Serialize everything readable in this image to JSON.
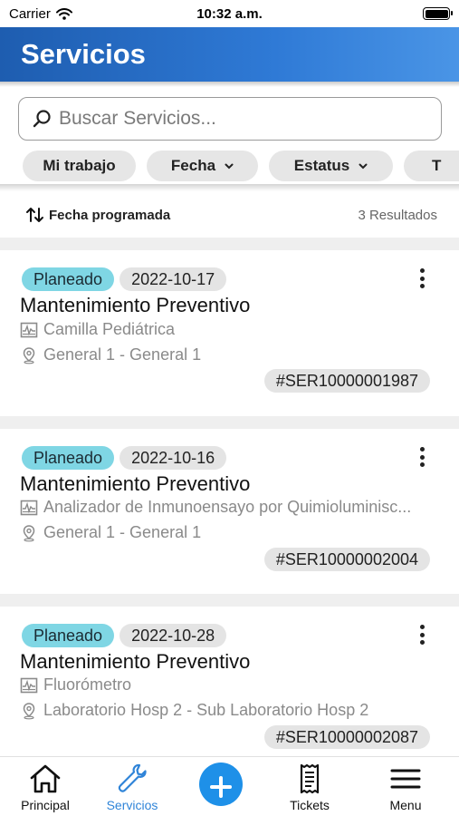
{
  "status_bar": {
    "carrier": "Carrier",
    "time": "10:32 a.m."
  },
  "header": {
    "title": "Servicios"
  },
  "search": {
    "placeholder": "Buscar Servicios..."
  },
  "filters": [
    {
      "label": "Mi trabajo",
      "has_dropdown": false
    },
    {
      "label": "Fecha",
      "has_dropdown": true
    },
    {
      "label": "Estatus",
      "has_dropdown": true
    },
    {
      "label": "T",
      "has_dropdown": false
    }
  ],
  "sort": {
    "label": "Fecha programada",
    "results": "3 Resultados"
  },
  "services": [
    {
      "status": "Planeado",
      "date": "2022-10-17",
      "title": "Mantenimiento Preventivo",
      "equipment": "Camilla Pediátrica",
      "location": "General 1 - General 1",
      "code": "#SER10000001987"
    },
    {
      "status": "Planeado",
      "date": "2022-10-16",
      "title": "Mantenimiento Preventivo",
      "equipment": "Analizador de Inmunoensayo por Quimioluminisc...",
      "location": "General 1 - General 1",
      "code": "#SER10000002004"
    },
    {
      "status": "Planeado",
      "date": "2022-10-28",
      "title": "Mantenimiento Preventivo",
      "equipment": "Fluorómetro",
      "location": "Laboratorio Hosp 2 - Sub Laboratorio Hosp 2",
      "code": "#SER10000002087"
    }
  ],
  "tabbar": {
    "items": [
      {
        "label": "Principal",
        "icon": "home-icon"
      },
      {
        "label": "Servicios",
        "icon": "wrench-icon",
        "active": true
      },
      {
        "label": "",
        "icon": "plus-icon"
      },
      {
        "label": "Tickets",
        "icon": "receipt-icon"
      },
      {
        "label": "Menu",
        "icon": "menu-icon"
      }
    ]
  },
  "colors": {
    "header": "#2f7ad6",
    "status_badge": "#7fd6e4",
    "accent": "#1e90e8",
    "active_tab": "#2f84d8"
  }
}
